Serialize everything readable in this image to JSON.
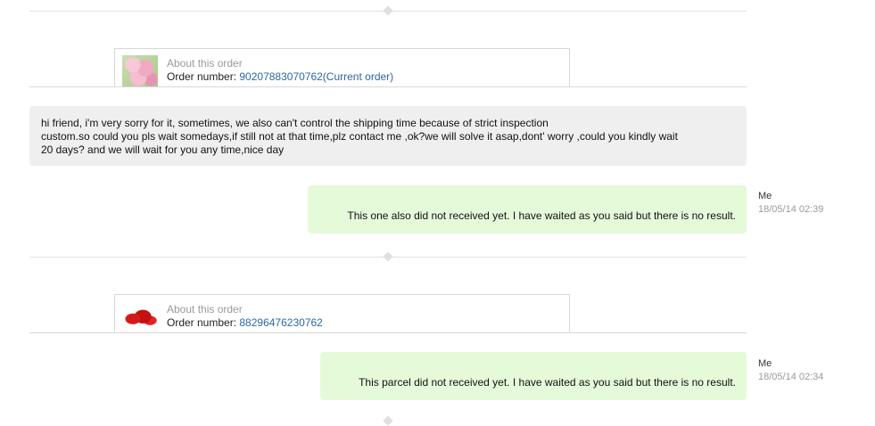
{
  "orders": [
    {
      "about_label": "About this order",
      "number_label": "Order number: ",
      "number_value": "90207883070762(Current order)",
      "thumb_icon": "pink-flower-product-thumbnail"
    },
    {
      "about_label": "About this order",
      "number_label": "Order number: ",
      "number_value": "88296476230762",
      "thumb_icon": "red-product-thumbnail"
    }
  ],
  "messages": [
    {
      "direction": "incoming",
      "lines": [
        "hi friend, i'm very sorry for it, sometimes, we also can't control the shipping time because of strict inspection",
        "custom.so could you pls wait somedays,if still not at that time,plz contact me ,ok?we will solve it asap,dont' worry ,could you kindly wait",
        "20 days? and we will wait for you any time,nice day"
      ]
    },
    {
      "direction": "outgoing",
      "text": "This one also did not received yet. I have waited as you said but there is no result.",
      "sender": "Me",
      "time": "18/05/14 02:39"
    },
    {
      "direction": "outgoing",
      "text": "This parcel did not received yet. I have waited as you said but there is no result.",
      "sender": "Me",
      "time": "18/05/14 02:34"
    }
  ],
  "colors": {
    "incoming_bubble": "#efefef",
    "outgoing_bubble": "#e5fad8",
    "link": "#2a68a8"
  }
}
